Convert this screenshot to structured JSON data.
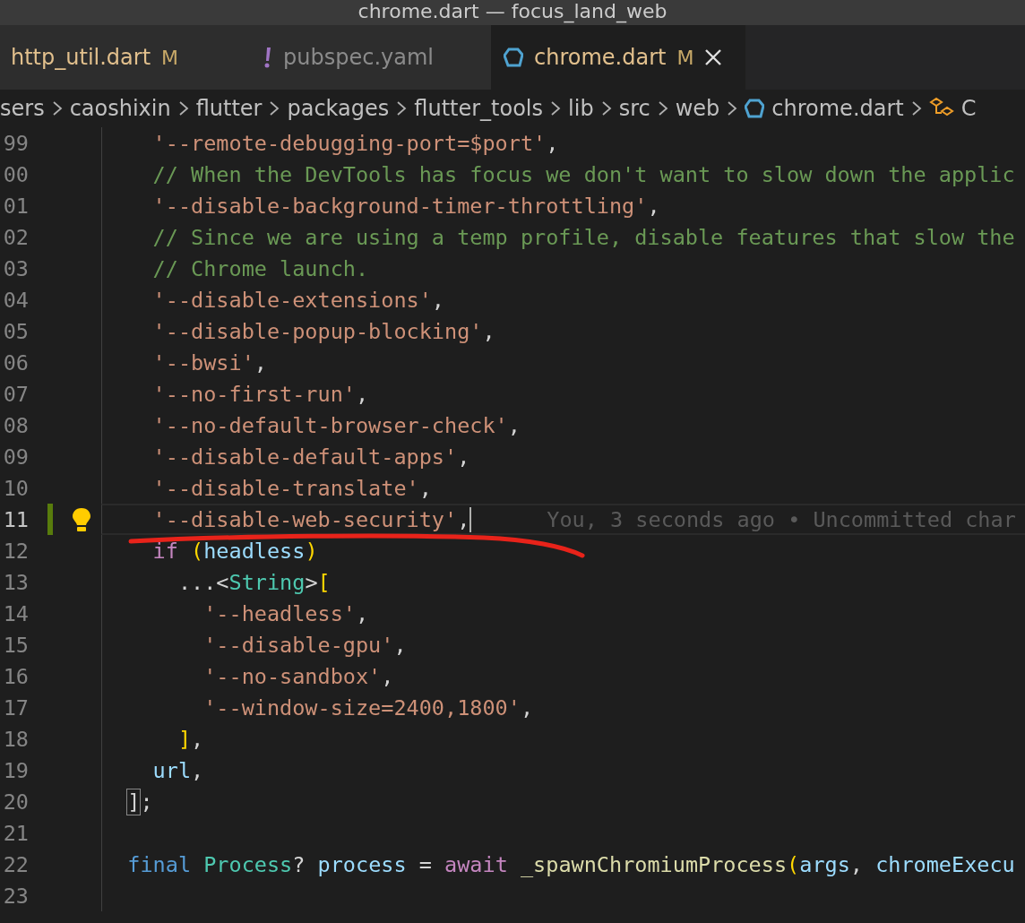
{
  "window": {
    "title": "chrome.dart — focus_land_web"
  },
  "tabs": [
    {
      "label": "http_util.dart",
      "kind": "dart",
      "badge": "M",
      "selected": false,
      "closable": false
    },
    {
      "label": "pubspec.yaml",
      "kind": "yaml",
      "selected": false,
      "closable": false
    },
    {
      "label": "chrome.dart",
      "kind": "dart",
      "badge": "M",
      "selected": true,
      "closable": true
    }
  ],
  "breadcrumb": [
    {
      "label": "sers",
      "kind": "folder"
    },
    {
      "label": "caoshixin",
      "kind": "folder"
    },
    {
      "label": "flutter",
      "kind": "folder"
    },
    {
      "label": "packages",
      "kind": "folder"
    },
    {
      "label": "flutter_tools",
      "kind": "folder"
    },
    {
      "label": "lib",
      "kind": "folder"
    },
    {
      "label": "src",
      "kind": "folder"
    },
    {
      "label": "web",
      "kind": "folder"
    },
    {
      "label": "chrome.dart",
      "kind": "dart"
    },
    {
      "label": "C",
      "kind": "symbol"
    }
  ],
  "lines": [
    {
      "number": "99",
      "tokens": [
        {
          "kind": "string",
          "text": "    '--remote-debugging-port=$port'"
        },
        {
          "kind": "plain",
          "text": ","
        }
      ]
    },
    {
      "number": "00",
      "tokens": [
        {
          "kind": "comment",
          "text": "    // When the DevTools has focus we don't want to slow down the applic"
        }
      ]
    },
    {
      "number": "01",
      "tokens": [
        {
          "kind": "string",
          "text": "    '--disable-background-timer-throttling'"
        },
        {
          "kind": "plain",
          "text": ","
        }
      ]
    },
    {
      "number": "02",
      "tokens": [
        {
          "kind": "comment",
          "text": "    // Since we are using a temp profile, disable features that slow the"
        }
      ]
    },
    {
      "number": "03",
      "tokens": [
        {
          "kind": "comment",
          "text": "    // Chrome launch."
        }
      ]
    },
    {
      "number": "04",
      "tokens": [
        {
          "kind": "string",
          "text": "    '--disable-extensions'"
        },
        {
          "kind": "plain",
          "text": ","
        }
      ]
    },
    {
      "number": "05",
      "tokens": [
        {
          "kind": "string",
          "text": "    '--disable-popup-blocking'"
        },
        {
          "kind": "plain",
          "text": ","
        }
      ]
    },
    {
      "number": "06",
      "tokens": [
        {
          "kind": "string",
          "text": "    '--bwsi'"
        },
        {
          "kind": "plain",
          "text": ","
        }
      ]
    },
    {
      "number": "07",
      "tokens": [
        {
          "kind": "string",
          "text": "    '--no-first-run'"
        },
        {
          "kind": "plain",
          "text": ","
        }
      ]
    },
    {
      "number": "08",
      "tokens": [
        {
          "kind": "string",
          "text": "    '--no-default-browser-check'"
        },
        {
          "kind": "plain",
          "text": ","
        }
      ]
    },
    {
      "number": "09",
      "tokens": [
        {
          "kind": "string",
          "text": "    '--disable-default-apps'"
        },
        {
          "kind": "plain",
          "text": ","
        }
      ]
    },
    {
      "number": "10",
      "tokens": [
        {
          "kind": "string",
          "text": "    '--disable-translate'"
        },
        {
          "kind": "plain",
          "text": ","
        }
      ]
    },
    {
      "number": "11",
      "current": true,
      "added": true,
      "lightbulb": true,
      "blame": "You, 3 seconds ago • Uncommitted char",
      "tokens": [
        {
          "kind": "string",
          "text": "    '--disable-web-security'"
        },
        {
          "kind": "plain",
          "text": ","
        }
      ]
    },
    {
      "number": "12",
      "tokens": [
        {
          "kind": "keyword",
          "text": "    if"
        },
        {
          "kind": "bracket",
          "text": " ("
        },
        {
          "kind": "variable",
          "text": "headless"
        },
        {
          "kind": "bracket",
          "text": ")"
        }
      ]
    },
    {
      "number": "13",
      "tokens": [
        {
          "kind": "plain",
          "text": "      ...<"
        },
        {
          "kind": "type",
          "text": "String"
        },
        {
          "kind": "plain",
          "text": ">"
        },
        {
          "kind": "bracket",
          "text": "["
        }
      ]
    },
    {
      "number": "14",
      "tokens": [
        {
          "kind": "string",
          "text": "        '--headless'"
        },
        {
          "kind": "plain",
          "text": ","
        }
      ]
    },
    {
      "number": "15",
      "tokens": [
        {
          "kind": "string",
          "text": "        '--disable-gpu'"
        },
        {
          "kind": "plain",
          "text": ","
        }
      ]
    },
    {
      "number": "16",
      "tokens": [
        {
          "kind": "string",
          "text": "        '--no-sandbox'"
        },
        {
          "kind": "plain",
          "text": ","
        }
      ]
    },
    {
      "number": "17",
      "tokens": [
        {
          "kind": "string",
          "text": "        '--window-size=2400,1800'"
        },
        {
          "kind": "plain",
          "text": ","
        }
      ]
    },
    {
      "number": "18",
      "tokens": [
        {
          "kind": "bracket",
          "text": "      ]"
        },
        {
          "kind": "plain",
          "text": ","
        }
      ]
    },
    {
      "number": "19",
      "tokens": [
        {
          "kind": "variable",
          "text": "    url"
        },
        {
          "kind": "plain",
          "text": ","
        }
      ]
    },
    {
      "number": "20",
      "tokens": [
        {
          "kind": "matched",
          "text": "  ]"
        },
        {
          "kind": "plain",
          "text": ";"
        }
      ]
    },
    {
      "number": "21"
    },
    {
      "number": "22",
      "tokens": [
        {
          "kind": "storage",
          "text": "  final"
        },
        {
          "kind": "type",
          "text": " Process"
        },
        {
          "kind": "plain",
          "text": "? "
        },
        {
          "kind": "variable",
          "text": "process"
        },
        {
          "kind": "plain",
          "text": " = "
        },
        {
          "kind": "keyword",
          "text": "await"
        },
        {
          "kind": "function",
          "text": " _spawnChromiumProcess"
        },
        {
          "kind": "bracket",
          "text": "("
        },
        {
          "kind": "variable",
          "text": "args"
        },
        {
          "kind": "plain",
          "text": ", "
        },
        {
          "kind": "variable",
          "text": "chromeExecu"
        }
      ]
    },
    {
      "number": "23"
    }
  ]
}
